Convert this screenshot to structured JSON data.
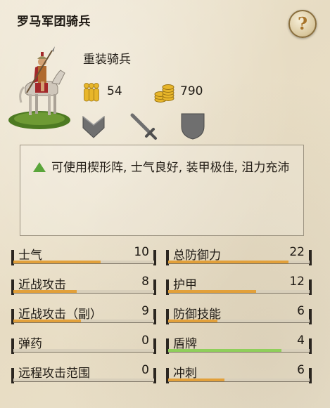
{
  "title": "罗马军团骑兵",
  "help_label": "?",
  "unit": {
    "type": "重装骑兵",
    "men": "54",
    "cost": "790"
  },
  "icons": {
    "help": "question-mark-icon",
    "men": "soldiers-icon",
    "cost": "gold-coins-icon",
    "abilities": [
      "chevron-formation-icon",
      "sword-icon",
      "shield-icon"
    ]
  },
  "description": "可使用楔形阵, 士气良好, 装甲极佳, 沮力充沛",
  "colors": {
    "bar_orange": "#e2a03a",
    "bar_green": "#8fcf5a",
    "ability_grey": "#6f6f6f",
    "triangle_green": "#5aa53a"
  },
  "stats_left": [
    {
      "label": "士气",
      "value": "10",
      "fill": 0.62,
      "color": "#e2a03a"
    },
    {
      "label": "近战攻击",
      "value": "8",
      "fill": 0.45,
      "color": "#e2a03a"
    },
    {
      "label": "近战攻击（副）",
      "value": "9",
      "fill": 0.48,
      "color": "#e2a03a"
    },
    {
      "label": "弹药",
      "value": "0",
      "fill": 0.0,
      "color": "#e2a03a"
    },
    {
      "label": "远程攻击范围",
      "value": "0",
      "fill": 0.0,
      "color": "#e2a03a"
    }
  ],
  "stats_right": [
    {
      "label": "总防御力",
      "value": "22",
      "fill": 0.85,
      "color": "#e2a03a"
    },
    {
      "label": "护甲",
      "value": "12",
      "fill": 0.62,
      "color": "#e2a03a"
    },
    {
      "label": "防御技能",
      "value": "6",
      "fill": 0.35,
      "color": "#e2a03a"
    },
    {
      "label": "盾牌",
      "value": "4",
      "fill": 0.8,
      "color": "#8fcf5a"
    },
    {
      "label": "冲刺",
      "value": "6",
      "fill": 0.4,
      "color": "#e2a03a"
    }
  ]
}
